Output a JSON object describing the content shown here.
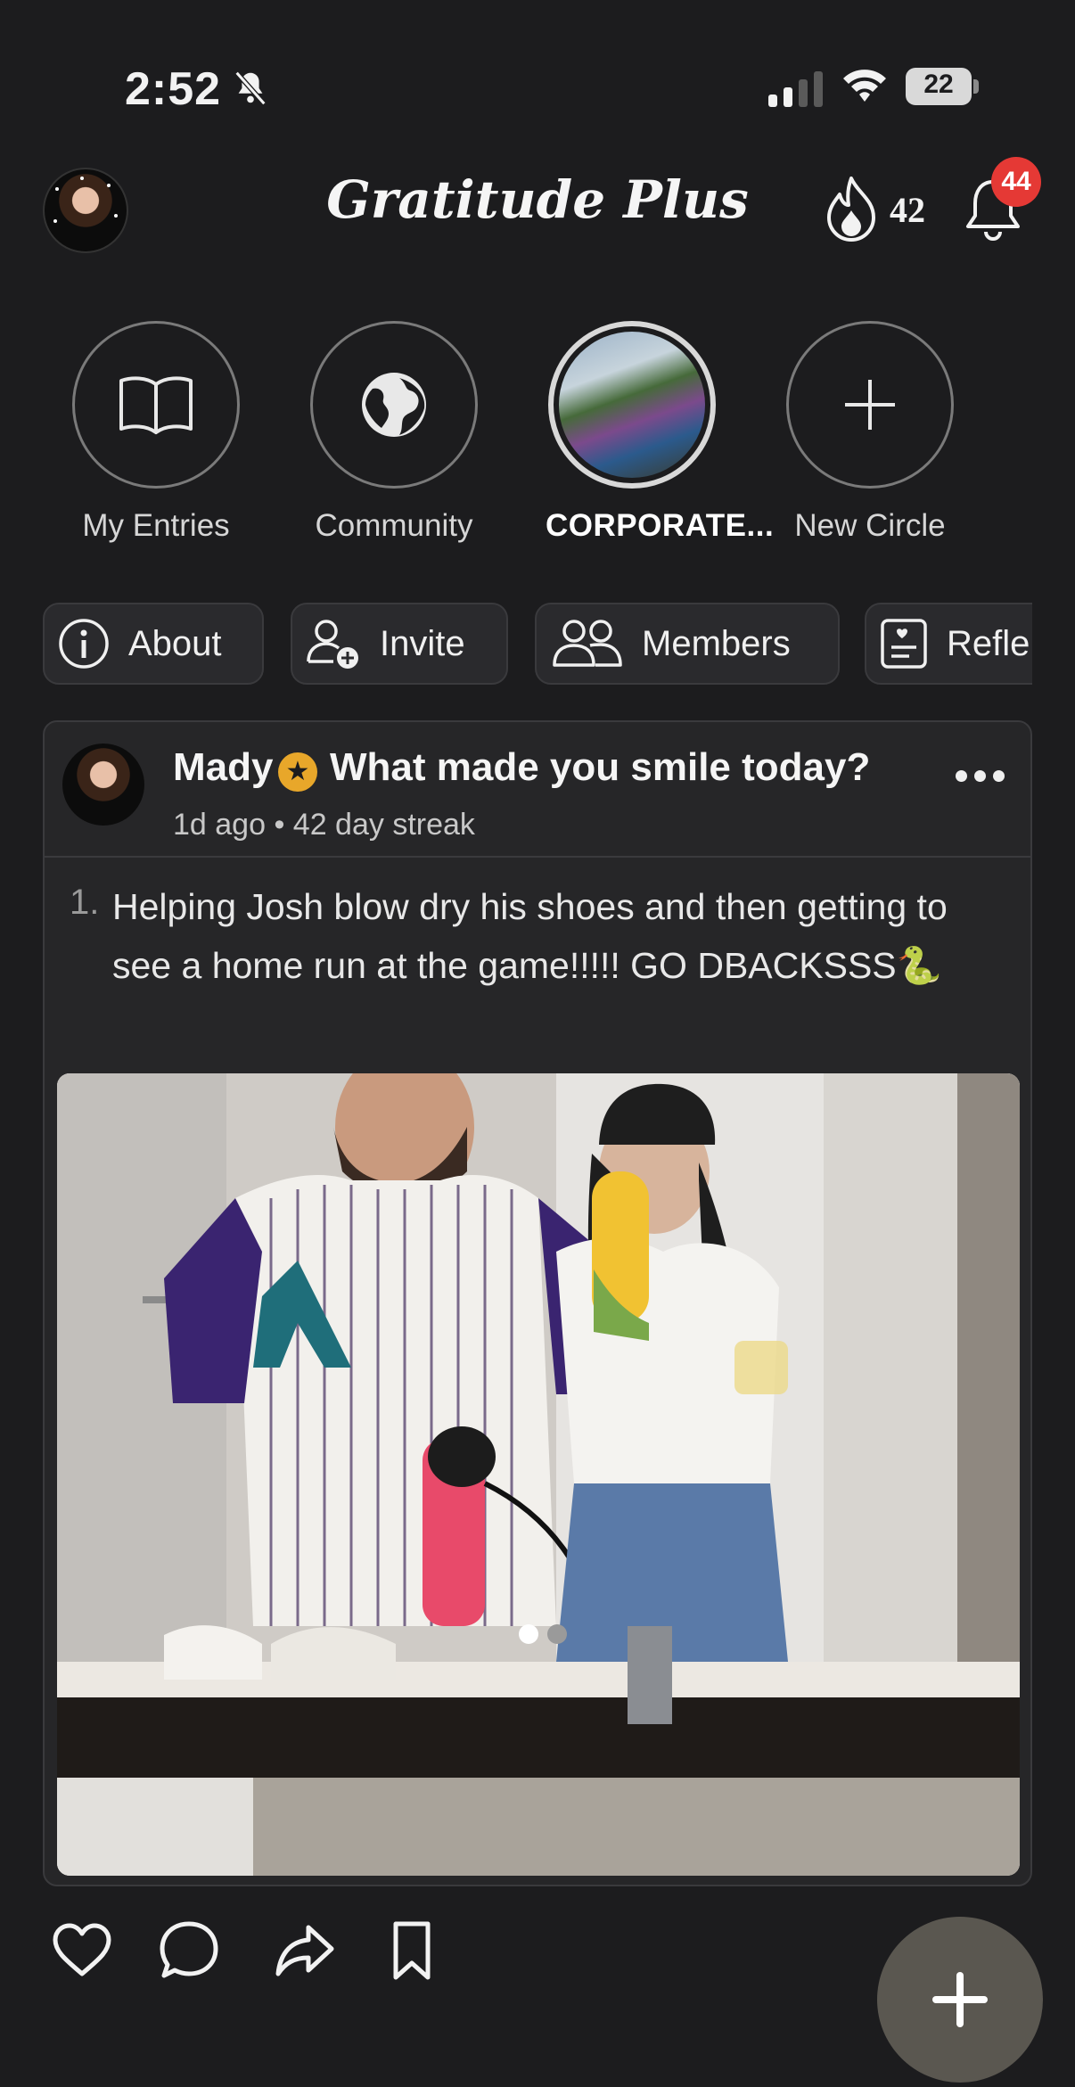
{
  "status_bar": {
    "time": "2:52",
    "battery": "22"
  },
  "header": {
    "title": "Gratitude Plus",
    "streak": "42",
    "notifications": "44"
  },
  "circles": [
    {
      "label": "My Entries",
      "icon": "book-icon"
    },
    {
      "label": "Community",
      "icon": "globe-icon"
    },
    {
      "label": "CORPORATE...",
      "icon": "group-photo"
    },
    {
      "label": "New Circle",
      "icon": "plus-icon"
    }
  ],
  "tabs": [
    {
      "label": "About",
      "icon": "info-icon"
    },
    {
      "label": "Invite",
      "icon": "add-user-icon"
    },
    {
      "label": "Members",
      "icon": "members-icon"
    },
    {
      "label": "Refle",
      "icon": "journal-icon"
    }
  ],
  "post": {
    "author": "Mady",
    "badge": "★",
    "prompt": "What made you smile today?",
    "meta": "1d ago • 42 day streak",
    "entry_number": "1.",
    "entry_text": "Helping Josh blow dry his shoes and then getting to see a home run at the game!!!!! GO DBACKSSS🐍",
    "photo_page": 1,
    "photo_pages": 2
  },
  "colors": {
    "background": "#1c1c1e",
    "card": "#262628",
    "badge": "#e53935",
    "verified": "#e8a72a",
    "fab": "#5a5750"
  }
}
